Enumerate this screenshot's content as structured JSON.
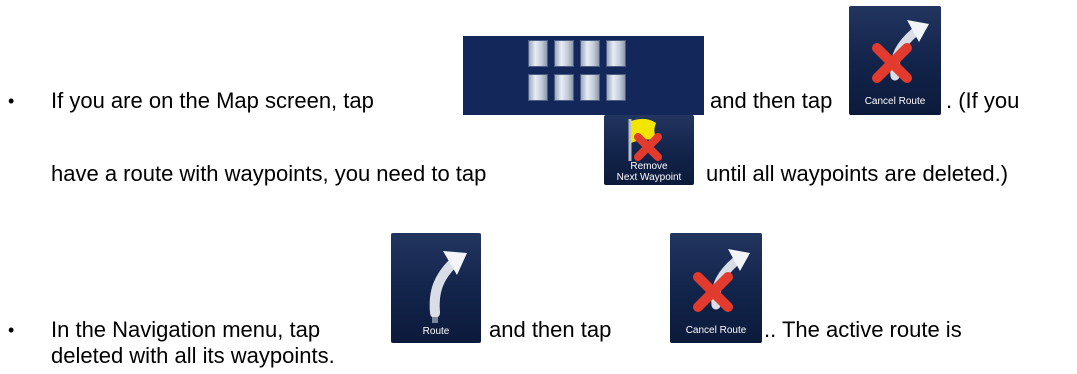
{
  "bullet_glyph": "•",
  "items": [
    {
      "line1": {
        "before": "If you are on the Map screen, tap",
        "middle": "and then tap",
        "after": ". (If you"
      },
      "line2": {
        "before": "have a route with waypoints, you need to tap",
        "after": "until all waypoints are deleted.)"
      }
    },
    {
      "line1": {
        "before": "In the Navigation menu, tap",
        "middle": "and then tap",
        "after": ".. The active route is"
      },
      "line2": "deleted with all its waypoints."
    }
  ],
  "buttons": {
    "menu": {
      "icon": "menu-grid-icon"
    },
    "cancel_route_1": {
      "label": "Cancel Route",
      "icon": "cancel-route-icon"
    },
    "remove_next_waypoint": {
      "label_line1": "Remove",
      "label_line2": "Next Waypoint",
      "icon": "remove-waypoint-icon"
    },
    "route": {
      "label": "Route",
      "icon": "route-arrow-icon"
    },
    "cancel_route_2": {
      "label": "Cancel Route",
      "icon": "cancel-route-icon"
    }
  },
  "colors": {
    "button_background": "#12234a",
    "menu_background": "#13275a",
    "cancel_x": "#e23b2e",
    "flag": "#f2e600"
  }
}
